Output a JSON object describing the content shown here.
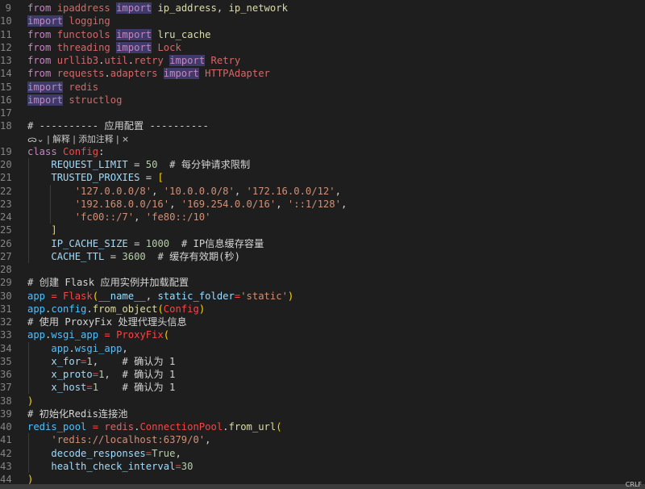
{
  "editor": {
    "lines": [
      {
        "n": "9",
        "tokens": [
          [
            "kw",
            "from"
          ],
          [
            "p",
            " "
          ],
          [
            "mod",
            "ipaddress"
          ],
          [
            "p",
            " "
          ],
          [
            "kwh",
            "import"
          ],
          [
            "p",
            " "
          ],
          [
            "fn",
            "ip_address"
          ],
          [
            "p",
            ", "
          ],
          [
            "fn",
            "ip_network"
          ]
        ]
      },
      {
        "n": "10",
        "tokens": [
          [
            "kwh",
            "import"
          ],
          [
            "p",
            " "
          ],
          [
            "mod",
            "logging"
          ]
        ]
      },
      {
        "n": "11",
        "tokens": [
          [
            "kw",
            "from"
          ],
          [
            "p",
            " "
          ],
          [
            "mod",
            "functools"
          ],
          [
            "p",
            " "
          ],
          [
            "kwh",
            "import"
          ],
          [
            "p",
            " "
          ],
          [
            "fn",
            "lru_cache"
          ]
        ]
      },
      {
        "n": "12",
        "tokens": [
          [
            "kw",
            "from"
          ],
          [
            "p",
            " "
          ],
          [
            "mod",
            "threading"
          ],
          [
            "p",
            " "
          ],
          [
            "kwh",
            "import"
          ],
          [
            "p",
            " "
          ],
          [
            "mod",
            "Lock"
          ]
        ]
      },
      {
        "n": "13",
        "tokens": [
          [
            "kw",
            "from"
          ],
          [
            "p",
            " "
          ],
          [
            "mod",
            "urllib3"
          ],
          [
            "p",
            "."
          ],
          [
            "mod",
            "util"
          ],
          [
            "p",
            "."
          ],
          [
            "mod",
            "retry"
          ],
          [
            "p",
            " "
          ],
          [
            "kwh",
            "import"
          ],
          [
            "p",
            " "
          ],
          [
            "mod",
            "Retry"
          ]
        ]
      },
      {
        "n": "14",
        "tokens": [
          [
            "kw",
            "from"
          ],
          [
            "p",
            " "
          ],
          [
            "mod",
            "requests"
          ],
          [
            "p",
            "."
          ],
          [
            "mod",
            "adapters"
          ],
          [
            "p",
            " "
          ],
          [
            "kwh",
            "import"
          ],
          [
            "p",
            " "
          ],
          [
            "mod",
            "HTTPAdapter"
          ]
        ]
      },
      {
        "n": "15",
        "tokens": [
          [
            "kwh",
            "import"
          ],
          [
            "p",
            " "
          ],
          [
            "mod",
            "redis"
          ]
        ]
      },
      {
        "n": "16",
        "tokens": [
          [
            "kwh",
            "import"
          ],
          [
            "p",
            " "
          ],
          [
            "mod",
            "structlog"
          ]
        ]
      },
      {
        "n": "17",
        "tokens": []
      },
      {
        "n": "18",
        "tokens": [
          [
            "cmt",
            "# ---------- 应用配置 ----------"
          ]
        ]
      },
      {
        "n": "19",
        "tokens": [
          [
            "kw",
            "class"
          ],
          [
            "p",
            " "
          ],
          [
            "cls",
            "Config"
          ],
          [
            "p",
            ":"
          ]
        ]
      },
      {
        "n": "20",
        "tokens": [
          [
            "p",
            "    "
          ],
          [
            "cn",
            "REQUEST_LIMIT"
          ],
          [
            "p",
            " = "
          ],
          [
            "num",
            "50"
          ],
          [
            "p",
            "  "
          ],
          [
            "cmt",
            "# 每分钟请求限制"
          ]
        ]
      },
      {
        "n": "21",
        "tokens": [
          [
            "p",
            "    "
          ],
          [
            "cn",
            "TRUSTED_PROXIES"
          ],
          [
            "p",
            " = "
          ],
          [
            "br1",
            "["
          ]
        ]
      },
      {
        "n": "22",
        "tokens": [
          [
            "p",
            "        "
          ],
          [
            "str",
            "'127.0.0.0/8'"
          ],
          [
            "p",
            ", "
          ],
          [
            "str",
            "'10.0.0.0/8'"
          ],
          [
            "p",
            ", "
          ],
          [
            "str",
            "'172.16.0.0/12'"
          ],
          [
            "p",
            ","
          ]
        ]
      },
      {
        "n": "23",
        "tokens": [
          [
            "p",
            "        "
          ],
          [
            "str",
            "'192.168.0.0/16'"
          ],
          [
            "p",
            ", "
          ],
          [
            "str",
            "'169.254.0.0/16'"
          ],
          [
            "p",
            ", "
          ],
          [
            "str",
            "'::1/128'"
          ],
          [
            "p",
            ","
          ]
        ]
      },
      {
        "n": "24",
        "tokens": [
          [
            "p",
            "        "
          ],
          [
            "str",
            "'fc00::/7'"
          ],
          [
            "p",
            ", "
          ],
          [
            "str",
            "'fe80::/10'"
          ]
        ]
      },
      {
        "n": "25",
        "tokens": [
          [
            "p",
            "    "
          ],
          [
            "br1",
            "]"
          ]
        ]
      },
      {
        "n": "26",
        "tokens": [
          [
            "p",
            "    "
          ],
          [
            "cn",
            "IP_CACHE_SIZE"
          ],
          [
            "p",
            " = "
          ],
          [
            "num",
            "1000"
          ],
          [
            "p",
            "  "
          ],
          [
            "cmt",
            "# IP信息缓存容量"
          ]
        ]
      },
      {
        "n": "27",
        "tokens": [
          [
            "p",
            "    "
          ],
          [
            "cn",
            "CACHE_TTL"
          ],
          [
            "p",
            " = "
          ],
          [
            "num",
            "3600"
          ],
          [
            "p",
            "  "
          ],
          [
            "cmt",
            "# 缓存有效期(秒)"
          ]
        ]
      },
      {
        "n": "28",
        "tokens": []
      },
      {
        "n": "29",
        "tokens": [
          [
            "cmt",
            "# 创建 Flask 应用实例并加载配置"
          ]
        ]
      },
      {
        "n": "30",
        "tokens": [
          [
            "var",
            "app"
          ],
          [
            "p",
            " "
          ],
          [
            "opr",
            "="
          ],
          [
            "p",
            " "
          ],
          [
            "cls",
            "Flask"
          ],
          [
            "br1",
            "("
          ],
          [
            "prm",
            "__name__"
          ],
          [
            "p",
            ", "
          ],
          [
            "prm",
            "static_folder"
          ],
          [
            "opr",
            "="
          ],
          [
            "str",
            "'static'"
          ],
          [
            "br1",
            ")"
          ]
        ]
      },
      {
        "n": "31",
        "tokens": [
          [
            "var",
            "app"
          ],
          [
            "p",
            "."
          ],
          [
            "var",
            "config"
          ],
          [
            "p",
            "."
          ],
          [
            "fn",
            "from_object"
          ],
          [
            "br1",
            "("
          ],
          [
            "cls",
            "Config"
          ],
          [
            "br1",
            ")"
          ]
        ]
      },
      {
        "n": "32",
        "tokens": [
          [
            "cmt",
            "# 使用 ProxyFix 处理代理头信息"
          ]
        ]
      },
      {
        "n": "33",
        "tokens": [
          [
            "var",
            "app"
          ],
          [
            "p",
            "."
          ],
          [
            "var",
            "wsgi_app"
          ],
          [
            "p",
            " "
          ],
          [
            "opr",
            "="
          ],
          [
            "p",
            " "
          ],
          [
            "cls",
            "ProxyFix"
          ],
          [
            "br1",
            "("
          ]
        ]
      },
      {
        "n": "34",
        "tokens": [
          [
            "p",
            "    "
          ],
          [
            "var",
            "app"
          ],
          [
            "p",
            "."
          ],
          [
            "var",
            "wsgi_app"
          ],
          [
            "p",
            ","
          ]
        ]
      },
      {
        "n": "35",
        "tokens": [
          [
            "p",
            "    "
          ],
          [
            "prm",
            "x_for"
          ],
          [
            "opr",
            "="
          ],
          [
            "num",
            "1"
          ],
          [
            "p",
            ",    "
          ],
          [
            "cmt",
            "# 确认为 1"
          ]
        ]
      },
      {
        "n": "36",
        "tokens": [
          [
            "p",
            "    "
          ],
          [
            "prm",
            "x_proto"
          ],
          [
            "opr",
            "="
          ],
          [
            "num",
            "1"
          ],
          [
            "p",
            ",  "
          ],
          [
            "cmt",
            "# 确认为 1"
          ]
        ]
      },
      {
        "n": "37",
        "tokens": [
          [
            "p",
            "    "
          ],
          [
            "prm",
            "x_host"
          ],
          [
            "opr",
            "="
          ],
          [
            "num",
            "1"
          ],
          [
            "p",
            "    "
          ],
          [
            "cmt",
            "# 确认为 1"
          ]
        ]
      },
      {
        "n": "38",
        "tokens": [
          [
            "br1",
            ")"
          ]
        ]
      },
      {
        "n": "39",
        "tokens": [
          [
            "cmt",
            "# 初始化Redis连接池"
          ]
        ]
      },
      {
        "n": "40",
        "tokens": [
          [
            "var",
            "redis_pool"
          ],
          [
            "p",
            " "
          ],
          [
            "opr",
            "="
          ],
          [
            "p",
            " "
          ],
          [
            "mod",
            "redis"
          ],
          [
            "p",
            "."
          ],
          [
            "cls",
            "ConnectionPool"
          ],
          [
            "p",
            "."
          ],
          [
            "fn",
            "from_url"
          ],
          [
            "br1",
            "("
          ]
        ]
      },
      {
        "n": "41",
        "tokens": [
          [
            "p",
            "    "
          ],
          [
            "str",
            "'redis://localhost:6379/0'"
          ],
          [
            "p",
            ","
          ]
        ]
      },
      {
        "n": "42",
        "tokens": [
          [
            "p",
            "    "
          ],
          [
            "prm",
            "decode_responses"
          ],
          [
            "opr",
            "="
          ],
          [
            "num",
            "True"
          ],
          [
            "p",
            ","
          ]
        ]
      },
      {
        "n": "43",
        "tokens": [
          [
            "p",
            "    "
          ],
          [
            "prm",
            "health_check_interval"
          ],
          [
            "opr",
            "="
          ],
          [
            "num",
            "30"
          ]
        ]
      },
      {
        "n": "44",
        "tokens": [
          [
            "br1",
            ")"
          ]
        ]
      }
    ],
    "codelens": {
      "icon": "ᯅ",
      "chevron": "⌄",
      "sep": " | ",
      "explain": "解释",
      "add_comment": "添加注释",
      "close": "×"
    }
  },
  "statusbar": {
    "right_text": "CRLF"
  }
}
